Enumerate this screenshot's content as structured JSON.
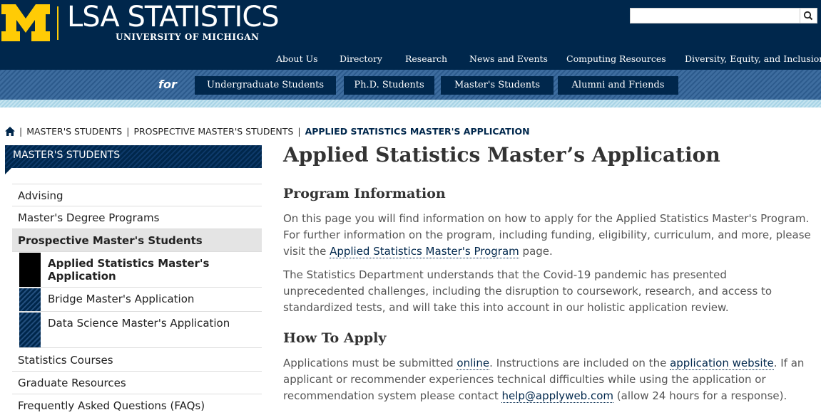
{
  "header": {
    "logo_lsa": "LSA STATISTICS",
    "logo_university": "UNIVERSITY OF MICHIGAN",
    "search_placeholder": "",
    "top_nav": [
      "About Us",
      "Directory",
      "Research",
      "News and Events",
      "Computing Resources",
      "Diversity, Equity, and Inclusion"
    ]
  },
  "audience": {
    "for_label": "for",
    "buttons": [
      "Undergraduate Students",
      "Ph.D. Students",
      "Master's Students",
      "Alumni and Friends"
    ]
  },
  "breadcrumb": {
    "items": [
      "MASTER'S STUDENTS",
      "PROSPECTIVE MASTER'S STUDENTS"
    ],
    "current": "APPLIED STATISTICS MASTER'S APPLICATION"
  },
  "sidebar": {
    "heading": "MASTER'S STUDENTS",
    "items": [
      "Advising",
      "Master's Degree Programs",
      "Prospective Master's Students"
    ],
    "sub_items": [
      "Applied Statistics Master's Application",
      "Bridge Master's Application",
      "Data Science Master's Application"
    ],
    "items_after": [
      "Statistics Courses",
      "Graduate Resources",
      "Frequently Asked Questions (FAQs)"
    ]
  },
  "main": {
    "title": "Applied Statistics Master’s Application",
    "section1_heading": "Program Information",
    "p1_before": "On this page you will find information on how to apply for the Applied Statistics Master's Program. For further information on the program, including funding, eligibility, curriculum, and more, please visit the ",
    "p1_link": "Applied Statistics Master's Program",
    "p1_after": " page.",
    "p2": "The Statistics Department understands that the Covid-19 pandemic has presented unprecedented challenges, including the disruption to coursework, research, and access to standardized tests, and will take this into account in our holistic application review.",
    "section2_heading": "How To Apply",
    "p3_a": "Applications must be submitted ",
    "p3_link1": "online",
    "p3_b": ". Instructions are included on the ",
    "p3_link2": "application website",
    "p3_c": ". If an applicant or recommender experiences technical difficulties while using the application or recommendation system please contact ",
    "p3_link3": "help@applyweb.com",
    "p3_d": " (allow 24 hours for a response)."
  },
  "colors": {
    "maize": "#ffcb05",
    "blue": "#00274c"
  }
}
